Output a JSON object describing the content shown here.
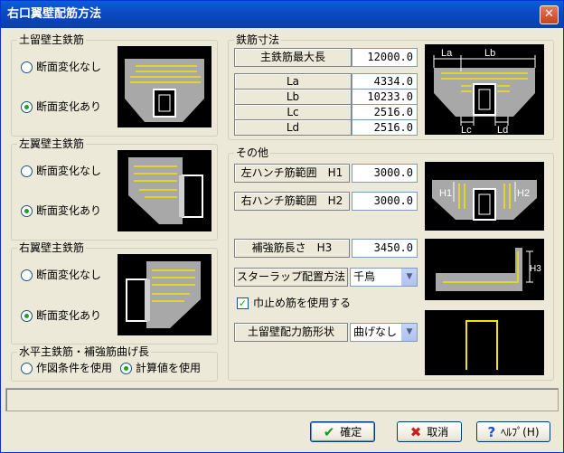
{
  "window": {
    "title": "右口翼壁配筋方法",
    "close_glyph": "✕"
  },
  "left_groups": [
    {
      "title": "土留壁主鉄筋",
      "opt1": "断面変化なし",
      "opt2": "断面変化あり",
      "selected": 2
    },
    {
      "title": "左翼壁主鉄筋",
      "opt1": "断面変化なし",
      "opt2": "断面変化あり",
      "selected": 2
    },
    {
      "title": "右翼壁主鉄筋",
      "opt1": "断面変化なし",
      "opt2": "断面変化あり",
      "selected": 2
    }
  ],
  "bend": {
    "title": "水平主鉄筋・補強筋曲げ長",
    "opt1": "作図条件を使用",
    "opt2": "計算値を使用",
    "selected": 2
  },
  "rebar": {
    "title": "鉄筋寸法",
    "max_label": "主鉄筋最大長",
    "max_value": "12000.0",
    "rows": [
      {
        "label": "La",
        "value": "4334.0"
      },
      {
        "label": "Lb",
        "value": "10233.0"
      },
      {
        "label": "Lc",
        "value": "2516.0"
      },
      {
        "label": "Ld",
        "value": "2516.0"
      }
    ],
    "diagram_labels": {
      "la": "La",
      "lb": "Lb",
      "lc": "Lc",
      "ld": "Ld"
    }
  },
  "other": {
    "title": "その他",
    "h1_label": "左ハンチ筋範囲　H1",
    "h1_value": "3000.0",
    "h2_label": "右ハンチ筋範囲　H2",
    "h2_value": "3000.0",
    "h3_label": "補強筋長さ　H3",
    "h3_value": "3450.0",
    "stirrup_label": "スターラップ配置方法",
    "stirrup_value": "千鳥",
    "check_label": "巾止め筋を使用する",
    "check_checked": true,
    "shape_label": "土留壁配力筋形状",
    "shape_value": "曲げなし",
    "diagram_labels": {
      "h1": "H1",
      "h2": "H2",
      "h3": "H3"
    }
  },
  "buttons": {
    "ok": "確定",
    "ok_icon": "✔",
    "cancel": "取消",
    "cancel_icon": "✖",
    "help": "ﾍﾙﾌﾟ(H)",
    "help_icon": "?"
  },
  "colors": {
    "title_bar": "#0b49c0",
    "diagram_bg": "#000000",
    "rebar_yellow": "#f2e500",
    "diagram_concrete": "#a8a8a8"
  }
}
